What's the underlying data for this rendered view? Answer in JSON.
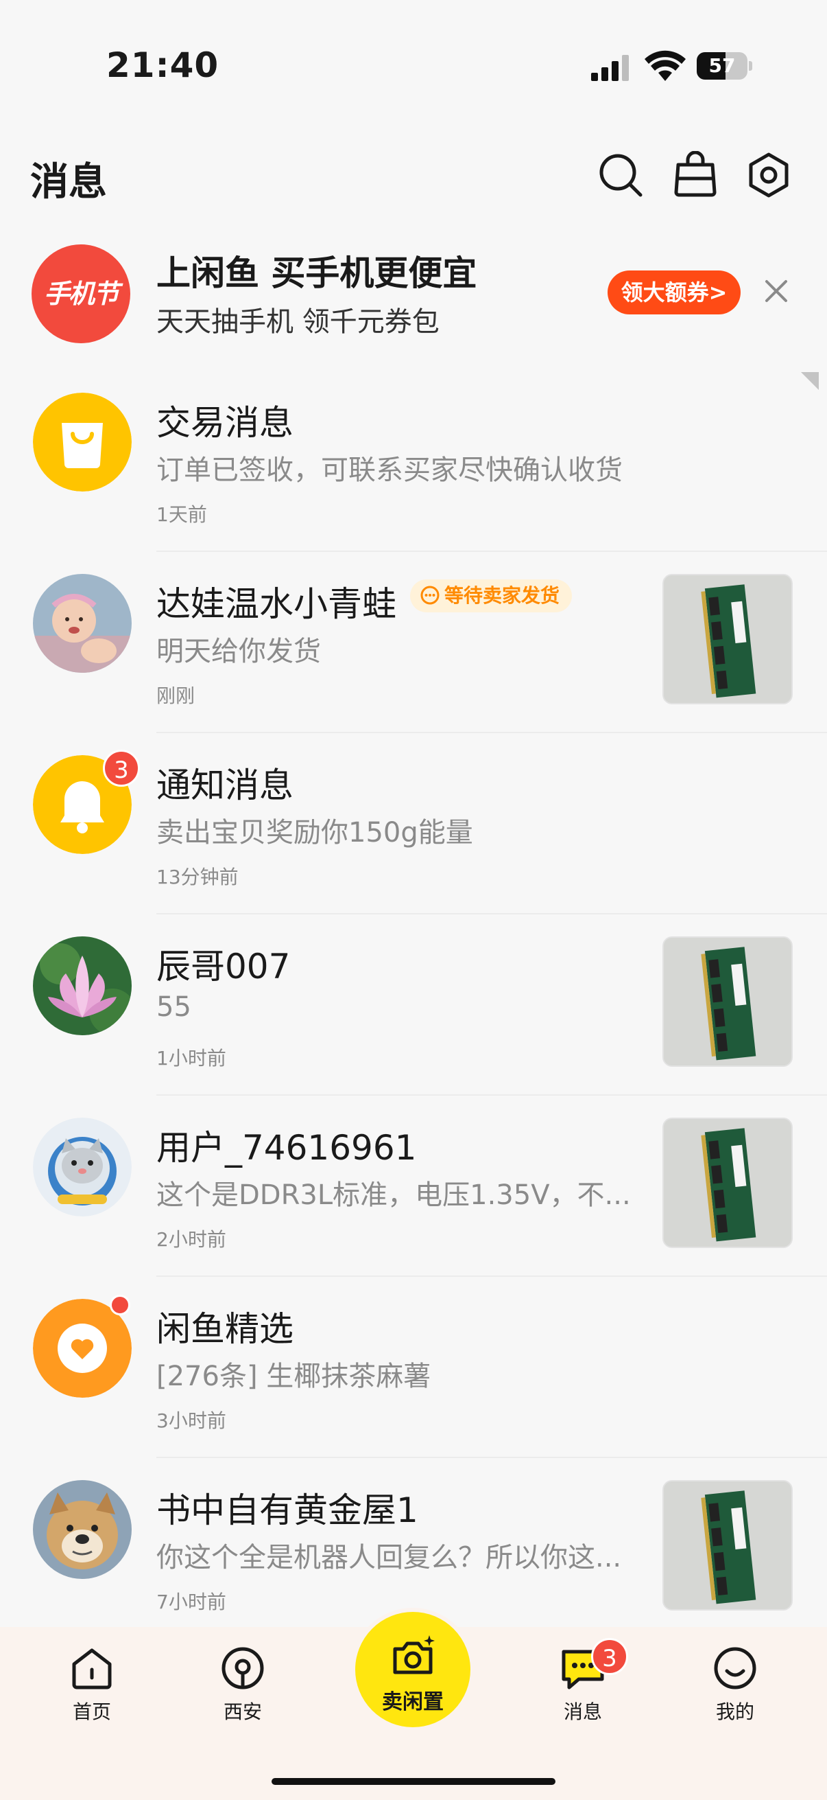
{
  "status_bar": {
    "time": "21:40",
    "battery": "57",
    "battery_level": 0.57
  },
  "header": {
    "title": "消息",
    "icons": [
      "search-icon",
      "shopping-bag-icon",
      "settings-icon"
    ]
  },
  "banner": {
    "logo_text": "手机节",
    "title": "上闲鱼 买手机更便宜",
    "subtitle": "天天抽手机 领千元券包",
    "button": "领大额券",
    "button_arrow": ">"
  },
  "conversations": [
    {
      "title": "交易消息",
      "message": "订单已签收，可联系买家尽快确认收货",
      "time": "1天前",
      "avatar": "shopping-bag-avatar"
    },
    {
      "title": "达娃温水小青蛙",
      "tag": "等待卖家发货",
      "message": "明天给你发货",
      "time": "刚刚",
      "avatar": "baby-photo-avatar",
      "thumb": "ram-module-thumb"
    },
    {
      "title": "通知消息",
      "message": "卖出宝贝奖励你150g能量",
      "time": "13分钟前",
      "avatar": "bell-avatar",
      "badge": "3"
    },
    {
      "title": "辰哥007",
      "message": "55",
      "time": "1小时前",
      "avatar": "lotus-photo-avatar",
      "thumb": "ram-module-thumb"
    },
    {
      "title": "用户_74616961",
      "message": "这个是DDR3L标准，电压1.35V，不...",
      "time": "2小时前",
      "avatar": "cat-astronaut-avatar",
      "thumb": "ram-module-thumb"
    },
    {
      "title": "闲鱼精选",
      "message": "[276条] 生椰抹茶麻薯",
      "time": "3小时前",
      "avatar": "heart-avatar",
      "dot": true
    },
    {
      "title": "书中自有黄金屋1",
      "message": "你这个全是机器人回复么？所以你这...",
      "time": "7小时前",
      "avatar": "dog-photo-avatar",
      "thumb": "ram-module-thumb"
    }
  ],
  "tabbar": {
    "tabs": [
      {
        "label": "首页",
        "icon": "home-icon"
      },
      {
        "label": "西安",
        "icon": "location-icon"
      },
      {
        "label": "卖闲置",
        "icon": "camera-icon"
      },
      {
        "label": "消息",
        "icon": "chat-icon",
        "badge": "3"
      },
      {
        "label": "我的",
        "icon": "smile-icon"
      }
    ]
  },
  "colors": {
    "brand_yellow": "#ffe60f",
    "accent_orange": "#ff4b15",
    "badge_red": "#f24a3d",
    "tag_orange": "#ff8a00"
  }
}
